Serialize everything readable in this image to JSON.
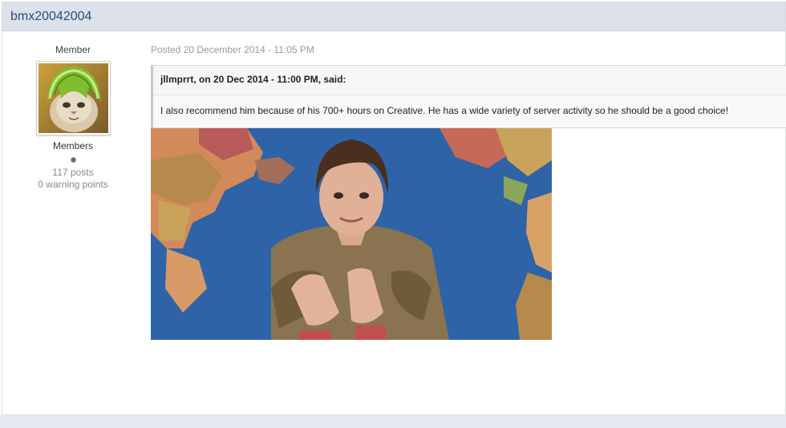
{
  "post": {
    "author": "bmx20042004",
    "member_title": "Member",
    "group": "Members",
    "post_count": "117 posts",
    "warning_points": "0 warning points",
    "posted_date": "Posted 20 December 2014 - 11:05 PM"
  },
  "quote": {
    "citation": "jllmprrt, on 20 Dec 2014 - 11:00 PM, said:",
    "text": "I also recommend him because of his 700+ hours on Creative. He has a wide variety of server activity so he should be a good choice!"
  },
  "colors": {
    "header_bg": "#dde1ea",
    "author_link": "#25507a",
    "meta_text": "#999999"
  },
  "icons": {
    "avatar": "cat-with-melon-hat-avatar",
    "image": "man-in-front-of-world-map-image",
    "reputation": "reputation-dot-icon"
  }
}
